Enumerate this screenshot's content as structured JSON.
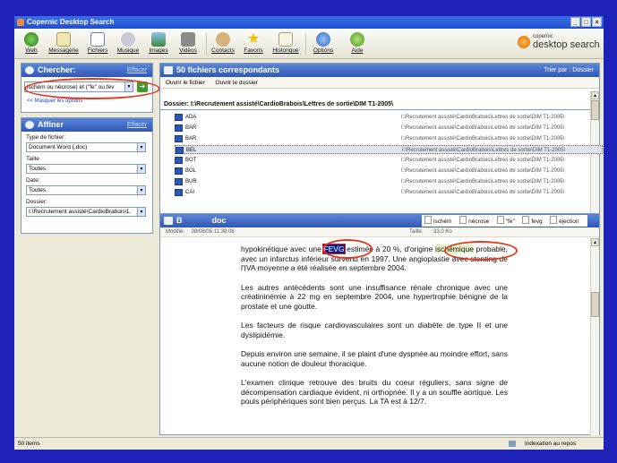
{
  "window": {
    "title": "Copernic Desktop Search"
  },
  "toolbar": {
    "items": [
      {
        "label": "Web",
        "icon": "web-globe-icon"
      },
      {
        "label": "Messagerie",
        "icon": "mail-icon"
      },
      {
        "label": "Fichiers",
        "icon": "files-icon"
      },
      {
        "label": "Musique",
        "icon": "music-icon"
      },
      {
        "label": "Images",
        "icon": "images-icon"
      },
      {
        "label": "Vidéos",
        "icon": "video-icon"
      },
      {
        "label": "Contacts",
        "icon": "contacts-icon"
      },
      {
        "label": "Favoris",
        "icon": "favorites-star-icon"
      },
      {
        "label": "Historique",
        "icon": "history-icon"
      },
      {
        "label": "Options",
        "icon": "options-icon"
      },
      {
        "label": "Aide",
        "icon": "help-icon"
      }
    ],
    "brand_small": "copernic",
    "brand_big": "desktop search"
  },
  "search": {
    "title": "Chercher:",
    "clear": "Effacer",
    "query": "ischém ou nécrose) et (\"fe\" ou fev",
    "hide_options": "<< Masquer les options"
  },
  "refine": {
    "title": "Affiner",
    "clear": "Effacer",
    "filetype_label": "Type de fichier:",
    "filetype_value": "Document Word (.doc)",
    "size_label": "Taille",
    "size_value": "Toutes",
    "date_label": "Date:",
    "date_value": "Toutes",
    "folder_label": "Dossier:",
    "folder_value": "I:\\Recrutement assisté\\CardioBrabois\\L"
  },
  "results": {
    "title": "50 fichiers correspondants",
    "sort": "Trier par : Dossier",
    "open_file": "Ouvrir le fichier",
    "open_folder": "Ouvrir le dossier",
    "folder_header": "Dossier: I:\\Recrutement assisté\\CardioBrabois\\Lettres de sortie\\DIM T1-2005\\",
    "files": [
      {
        "name": "ADA",
        "path": "I:\\Recrutement assisté\\CardioBrabois\\Lettres de sortie\\DIM T1-2005\\"
      },
      {
        "name": "BAR",
        "path": "I:\\Recrutement assisté\\CardioBrabois\\Lettres de sortie\\DIM T1-2005\\"
      },
      {
        "name": "BAR",
        "path": "I:\\Recrutement assisté\\CardioBrabois\\Lettres de sortie\\DIM T1-2005\\"
      },
      {
        "name": "BEL",
        "path": "I:\\Recrutement assisté\\CardioBrabois\\Lettres de sortie\\DIM T1-2005\\"
      },
      {
        "name": "BOT",
        "path": "I:\\Recrutement assisté\\CardioBrabois\\Lettres de sortie\\DIM T1-2005\\"
      },
      {
        "name": "BOL",
        "path": "I:\\Recrutement assisté\\CardioBrabois\\Lettres de sortie\\DIM T1-2005\\"
      },
      {
        "name": "BUR",
        "path": "I:\\Recrutement assisté\\CardioBrabois\\Lettres de sortie\\DIM T1-2005\\"
      },
      {
        "name": "CAI",
        "path": "I:\\Recrutement assisté\\CardioBrabois\\Lettres de sortie\\DIM T1-2005\\"
      }
    ]
  },
  "preview": {
    "title_prefix": "B",
    "title_suffix": "doc",
    "tags": [
      "ischém",
      "nécrose",
      "\"fe\"",
      "fevg",
      "éjection"
    ],
    "modified_label": "Modifié:",
    "modified_value": "08/08/05 11:39:08",
    "size_label": "Taille:",
    "size_value": "33.0 Ko",
    "line1_a": "hypokinétique avec une ",
    "line1_mark": "FEVG",
    "line1_b": " estimée à 20 %, d'origine ",
    "line1_mark2": "ischémique",
    "line1_c": " probable, avec un infarctus inférieur survenu en 1997. Une angioplastie avec stenting de l'IVA moyenne a été réalisée en septembre 2004.",
    "paragraphs": [
      "Les autres antécédents sont une insuffisance rénale chronique avec une créatininémie à 22 mg en septembre 2004, une hypertrophie bénigne de la prostate et une goutte.",
      "Les facteurs de risque cardiovasculaires sont un diabète de type II et une dyslipidémie.",
      "Depuis environ une semaine, il se plaint d'une dyspnée au moindre effort, sans aucune notion de douleur thoracique.",
      "L'examen clinique retrouve des bruits du coeur réguliers, sans signe de décompensation cardiaque évident, ni orthopnée. Il y a un souffle aortique. Les pouls périphériques sont bien perçus. La TA est à 12/7."
    ]
  },
  "status": {
    "count": "50 items",
    "indexing": "Indexation au repos"
  },
  "colors": {
    "desktop": "#1f22b8",
    "panel_header": "#2f57b6",
    "annotation": "#e3381f"
  }
}
